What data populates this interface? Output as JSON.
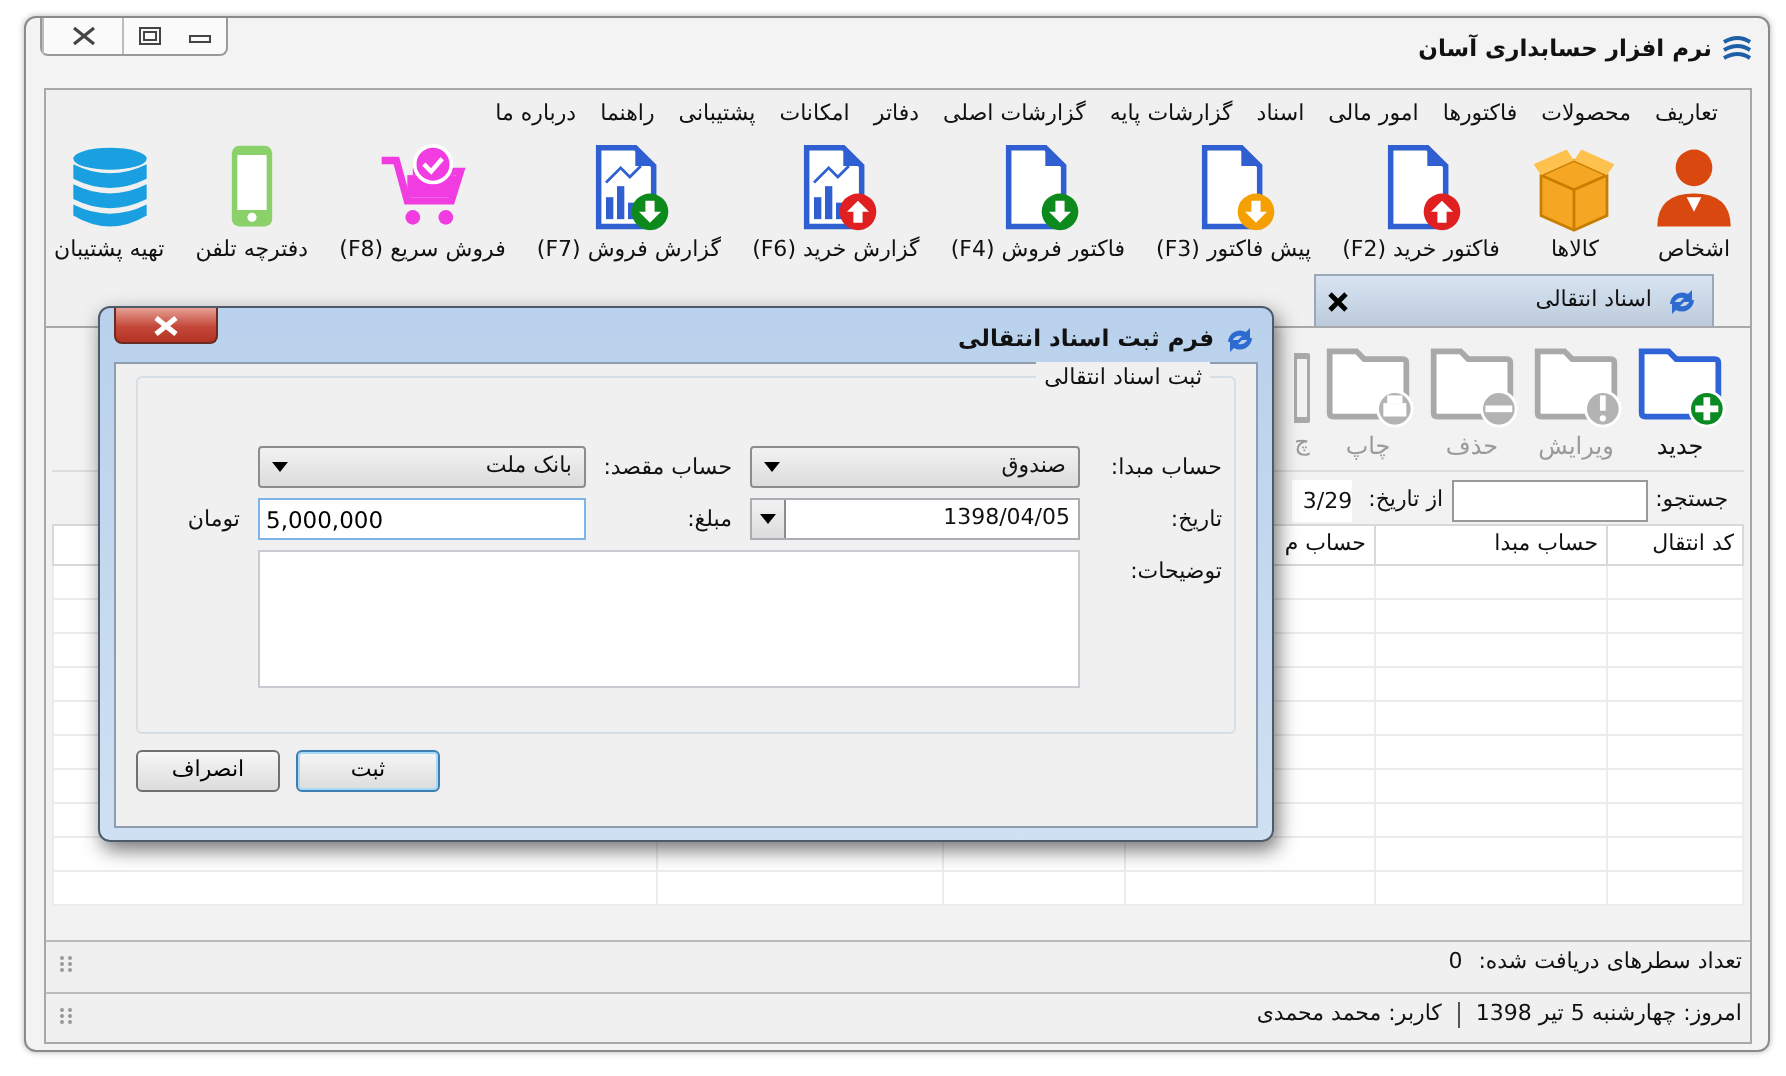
{
  "window": {
    "title": "نرم افزار حسابداری آسان"
  },
  "menu": [
    {
      "label": "تعاریف"
    },
    {
      "label": "محصولات"
    },
    {
      "label": "فاکتورها"
    },
    {
      "label": "امور مالی"
    },
    {
      "label": "اسناد"
    },
    {
      "label": "گزارشات پایه"
    },
    {
      "label": "گزارشات اصلی"
    },
    {
      "label": "دفاتر"
    },
    {
      "label": "امکانات"
    },
    {
      "label": "پشتیبانی"
    },
    {
      "label": "راهنما"
    },
    {
      "label": "درباره ما"
    }
  ],
  "toolbar": [
    {
      "label": "اشخاص",
      "kind": "people"
    },
    {
      "label": "کالاها",
      "kind": "goods"
    },
    {
      "label": "فاکتور خرید (F2)",
      "kind": "purchase"
    },
    {
      "label": "پیش فاکتور (F3)",
      "kind": "proforma"
    },
    {
      "label": "فاکتور فروش (F4)",
      "kind": "sale"
    },
    {
      "label": "گزارش خرید (F6)",
      "kind": "purchase-report"
    },
    {
      "label": "گزارش فروش (F7)",
      "kind": "sale-report"
    },
    {
      "label": "فروش سریع (F8)",
      "kind": "quick-sale"
    },
    {
      "label": "دفترچه تلفن",
      "kind": "phonebook"
    },
    {
      "label": "تهیه پشتیبان",
      "kind": "backup"
    }
  ],
  "tabs": [
    {
      "label": "اسناد انتقالی",
      "selected": true
    }
  ],
  "actions": [
    {
      "label": "جدید",
      "kind": "new",
      "disabled": false
    },
    {
      "label": "ویرایش",
      "kind": "edit",
      "disabled": true
    },
    {
      "label": "حذف",
      "kind": "delete",
      "disabled": true
    },
    {
      "label": "چاپ",
      "kind": "print",
      "disabled": true
    },
    {
      "label": "چ",
      "kind": "partial",
      "disabled": true
    }
  ],
  "search": {
    "label": "جستجو:",
    "from_label": "از تاریخ:",
    "from_value": "3/29"
  },
  "table": {
    "columns": [
      "کد انتقال",
      "حساب مبدا",
      "حساب م"
    ]
  },
  "status": {
    "rows_label": "تعداد سطرهای دریافت شده:",
    "rows_value": "0",
    "today": "امروز: چهارشنبه 5 تیر 1398",
    "user": "کاربر: محمد محمدی"
  },
  "dialog": {
    "title": "فرم ثبت اسناد انتقالی",
    "group": "ثبت اسناد انتقالی",
    "source": {
      "label": "حساب مبدا:",
      "value": "صندوق"
    },
    "destination": {
      "label": "حساب مقصد:",
      "value": "بانک ملت"
    },
    "date": {
      "label": "تاریخ:",
      "value": "1398/04/05"
    },
    "amount": {
      "label": "مبلغ:",
      "value": "5,000,000",
      "unit": "تومان"
    },
    "notes": {
      "label": "توضیحات:"
    },
    "buttons": [
      {
        "label": "ثبت",
        "default": true
      },
      {
        "label": "انصراف",
        "default": false
      }
    ]
  }
}
